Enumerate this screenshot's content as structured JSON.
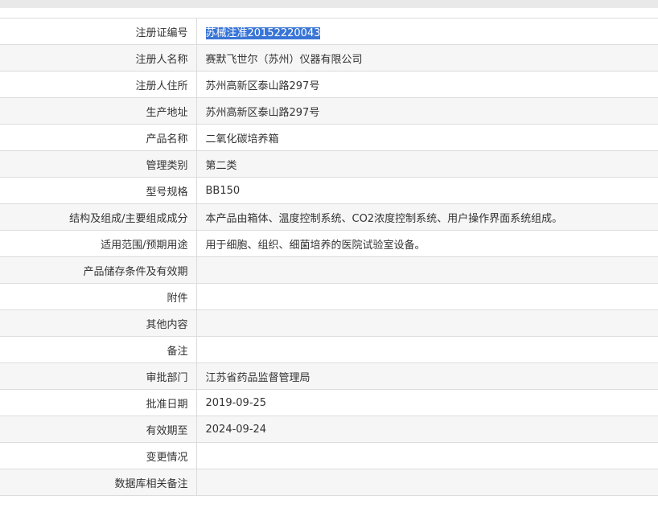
{
  "rows": [
    {
      "label": "注册证编号",
      "value": "苏械注准20152220043",
      "selected": true
    },
    {
      "label": "注册人名称",
      "value": "赛默飞世尔（苏州）仪器有限公司"
    },
    {
      "label": "注册人住所",
      "value": "苏州高新区泰山路297号"
    },
    {
      "label": "生产地址",
      "value": "苏州高新区泰山路297号"
    },
    {
      "label": "产品名称",
      "value": "二氧化碳培养箱"
    },
    {
      "label": "管理类别",
      "value": "第二类"
    },
    {
      "label": "型号规格",
      "value": "BB150"
    },
    {
      "label": "结构及组成/主要组成成分",
      "value": "本产品由箱体、温度控制系统、CO2浓度控制系统、用户操作界面系统组成。"
    },
    {
      "label": "适用范围/预期用途",
      "value": "用于细胞、组织、细菌培养的医院试验室设备。"
    },
    {
      "label": "产品储存条件及有效期",
      "value": ""
    },
    {
      "label": "附件",
      "value": ""
    },
    {
      "label": "其他内容",
      "value": ""
    },
    {
      "label": "备注",
      "value": ""
    },
    {
      "label": "审批部门",
      "value": "江苏省药品监督管理局"
    },
    {
      "label": "批准日期",
      "value": "2019-09-25"
    },
    {
      "label": "有效期至",
      "value": "2024-09-24"
    },
    {
      "label": "变更情况",
      "value": ""
    },
    {
      "label": "数据库相关备注",
      "value": ""
    }
  ],
  "colors": {
    "selection": "#3875d7",
    "row_alt": "#f6f6f6",
    "border": "#dcdcdc"
  }
}
